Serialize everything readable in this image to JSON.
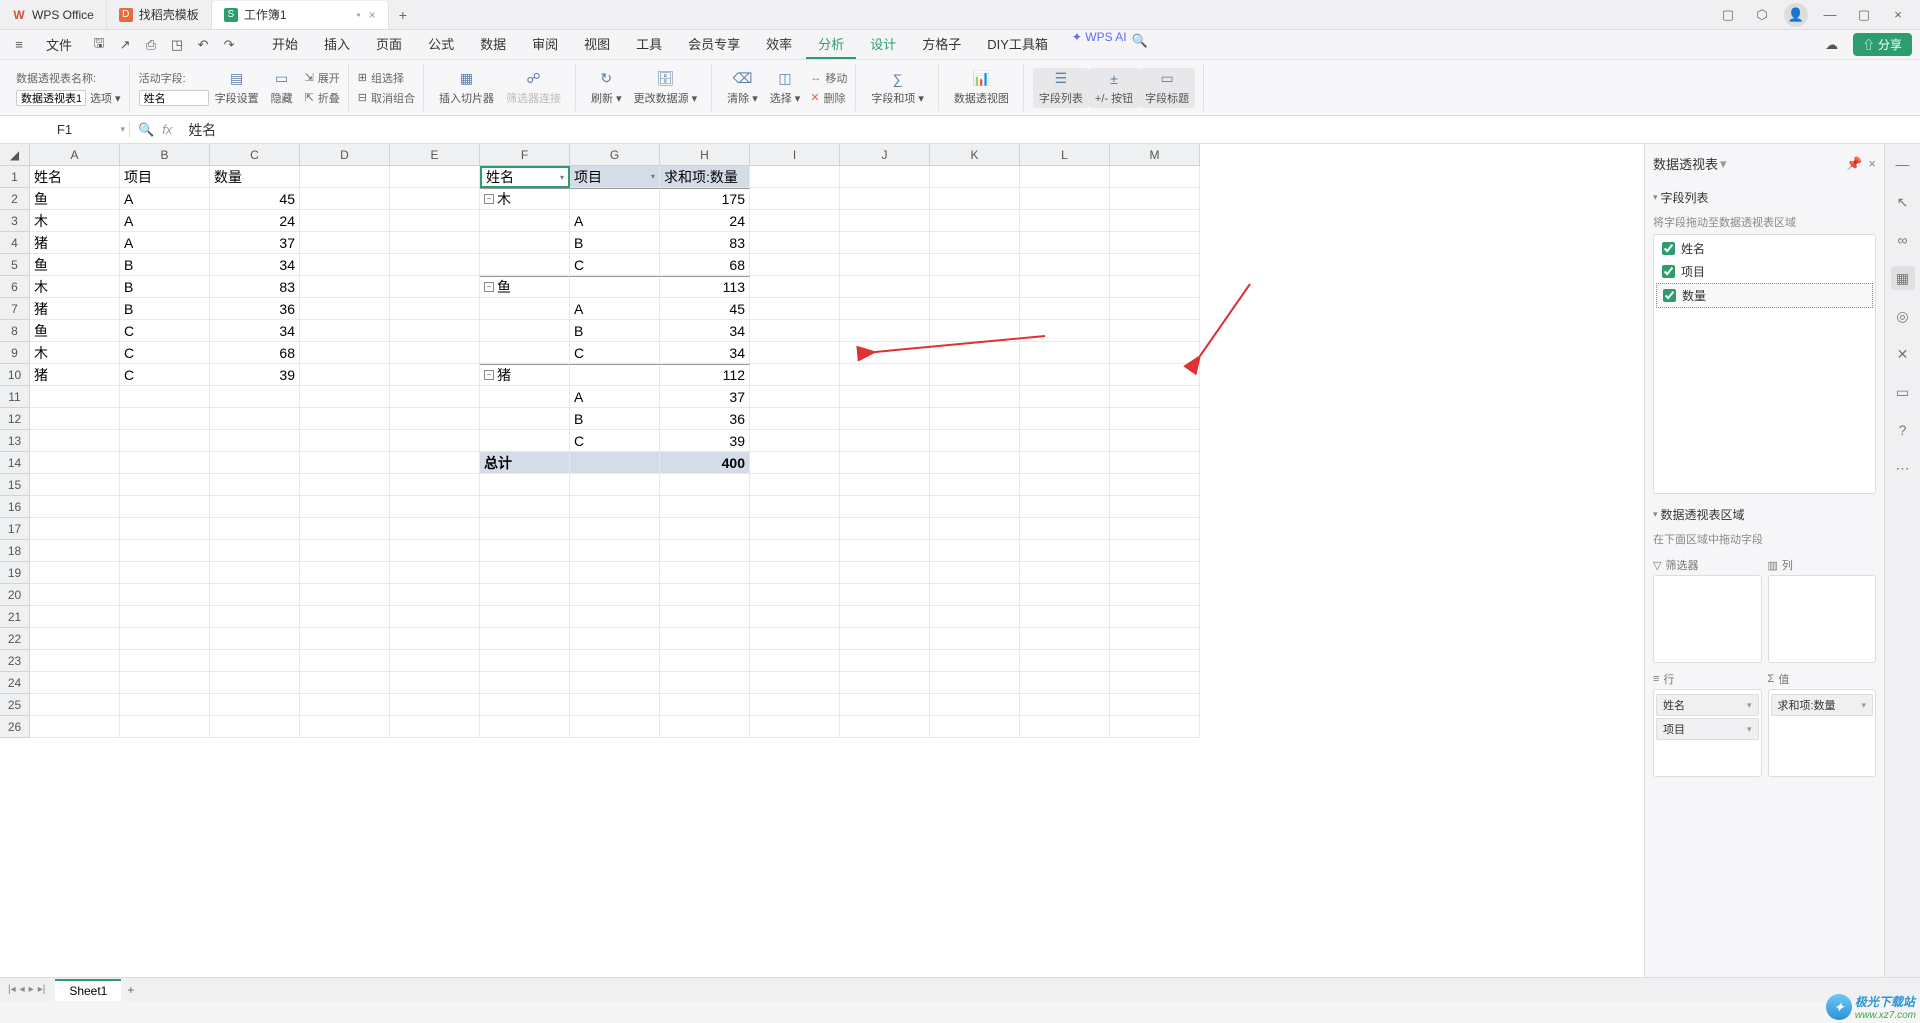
{
  "titlebar": {
    "tabs": [
      {
        "name": "WPS Office",
        "color": "#d94e3e"
      },
      {
        "name": "找稻壳模板",
        "color": "#e86b3f"
      },
      {
        "name": "工作簿1",
        "color": "#2d9d6e",
        "active": true,
        "dirty": "•"
      }
    ],
    "add": "+"
  },
  "menu": {
    "file": "文件",
    "tabs": [
      "开始",
      "插入",
      "页面",
      "公式",
      "数据",
      "审阅",
      "视图",
      "工具",
      "会员专享",
      "效率",
      "分析",
      "设计",
      "方格子",
      "DIY工具箱"
    ],
    "ai": "WPS AI",
    "share": "分享"
  },
  "toolbar": {
    "nameLabel": "数据透视表名称:",
    "nameValue": "数据透视表1",
    "options": "选项",
    "activeFieldLabel": "活动字段:",
    "activeFieldValue": "姓名",
    "fieldSettings": "字段设置",
    "hide": "隐藏",
    "expand": "展开",
    "collapse": "折叠",
    "group": "组选择",
    "ungroup": "取消组合",
    "insertSlicer": "插入切片器",
    "slicerConnect": "筛选器连接",
    "refresh": "刷新",
    "changeSource": "更改数据源",
    "clear": "清除",
    "select": "选择",
    "move": "移动",
    "delete": "删除",
    "fieldsItems": "字段和项",
    "pivotChart": "数据透视图",
    "fieldList": "字段列表",
    "plusMinusBtn": "+/- 按钮",
    "fieldTitle": "字段标题"
  },
  "formula": {
    "nameBox": "F1",
    "value": "姓名"
  },
  "cols": [
    "A",
    "B",
    "C",
    "D",
    "E",
    "F",
    "G",
    "H",
    "I",
    "J",
    "K",
    "L",
    "M"
  ],
  "data": {
    "headers": {
      "A": "姓名",
      "B": "项目",
      "C": "数量"
    },
    "rows": [
      {
        "A": "鱼",
        "B": "A",
        "C": "45"
      },
      {
        "A": "木",
        "B": "A",
        "C": "24"
      },
      {
        "A": "猪",
        "B": "A",
        "C": "37"
      },
      {
        "A": "鱼",
        "B": "B",
        "C": "34"
      },
      {
        "A": "木",
        "B": "B",
        "C": "83"
      },
      {
        "A": "猪",
        "B": "B",
        "C": "36"
      },
      {
        "A": "鱼",
        "B": "C",
        "C": "34"
      },
      {
        "A": "木",
        "B": "C",
        "C": "68"
      },
      {
        "A": "猪",
        "B": "C",
        "C": "39"
      }
    ]
  },
  "pivot": {
    "h1": "姓名",
    "h2": "项目",
    "h3": "求和项:数量",
    "groups": [
      {
        "name": "木",
        "total": "175",
        "items": [
          {
            "p": "A",
            "v": "24"
          },
          {
            "p": "B",
            "v": "83"
          },
          {
            "p": "C",
            "v": "68"
          }
        ]
      },
      {
        "name": "鱼",
        "total": "113",
        "items": [
          {
            "p": "A",
            "v": "45"
          },
          {
            "p": "B",
            "v": "34"
          },
          {
            "p": "C",
            "v": "34"
          }
        ]
      },
      {
        "name": "猪",
        "total": "112",
        "items": [
          {
            "p": "A",
            "v": "37"
          },
          {
            "p": "B",
            "v": "36"
          },
          {
            "p": "C",
            "v": "39"
          }
        ]
      }
    ],
    "totalLabel": "总计",
    "totalValue": "400"
  },
  "panel": {
    "title": "数据透视表",
    "fieldListTitle": "字段列表",
    "fieldListHint": "将字段拖动至数据透视表区域",
    "fields": [
      "姓名",
      "项目",
      "数量"
    ],
    "areaTitle": "数据透视表区域",
    "areaHint": "在下面区域中拖动字段",
    "filter": "筛选器",
    "col": "列",
    "row": "行",
    "val": "值",
    "rowTags": [
      "姓名",
      "项目"
    ],
    "valTags": [
      "求和项:数量"
    ]
  },
  "sheet": {
    "name": "Sheet1"
  },
  "watermark": {
    "cn": "极光下载站",
    "url": "www.xz7.com"
  }
}
